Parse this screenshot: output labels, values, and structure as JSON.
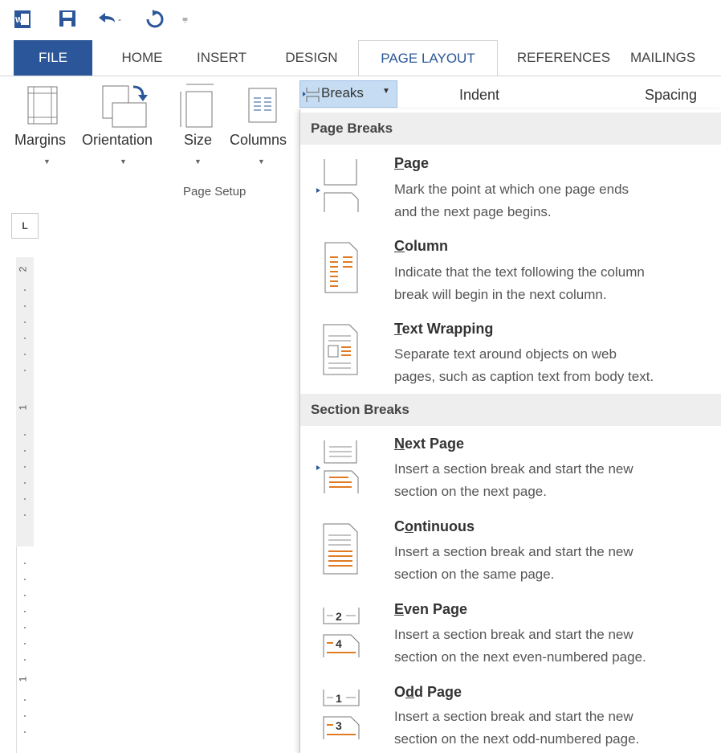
{
  "tabs": [
    "FILE",
    "HOME",
    "INSERT",
    "DESIGN",
    "PAGE LAYOUT",
    "REFERENCES",
    "MAILINGS"
  ],
  "ribbon": {
    "buttons": [
      "Margins",
      "Orientation",
      "Size",
      "Columns"
    ],
    "group_label": "Page Setup",
    "breaks_label": "Breaks",
    "indent_label": "Indent",
    "spacing_label": "Spacing"
  },
  "ruler": {
    "tab_selector": "L",
    "numbers": [
      "2",
      "1",
      "1"
    ]
  },
  "menu": {
    "page_breaks_header": "Page Breaks",
    "section_breaks_header": "Section Breaks",
    "items": [
      {
        "pre": "",
        "u": "P",
        "post": "age",
        "desc1": "Mark the point at which one page ends",
        "desc2": "and the next page begins."
      },
      {
        "pre": "",
        "u": "C",
        "post": "olumn",
        "desc1": "Indicate that the text following the column",
        "desc2": "break will begin in the next column."
      },
      {
        "pre": "",
        "u": "T",
        "post": "ext Wrapping",
        "desc1": "Separate text around objects on web",
        "desc2": "pages, such as caption text from body text."
      },
      {
        "pre": "",
        "u": "N",
        "post": "ext Page",
        "desc1": "Insert a section break and start the new",
        "desc2": "section on the next page."
      },
      {
        "pre": "C",
        "u": "o",
        "post": "ntinuous",
        "desc1": "Insert a section break and start the new",
        "desc2": "section on the same page."
      },
      {
        "pre": "",
        "u": "E",
        "post": "ven Page",
        "desc1": "Insert a section break and start the new",
        "desc2": "section on the next even-numbered page."
      },
      {
        "pre": "O",
        "u": "d",
        "post": "d Page",
        "desc1": "Insert a section break and start the new",
        "desc2": "section on the next odd-numbered page."
      }
    ]
  },
  "icons": {
    "word": "word-app-icon",
    "save": "save-icon",
    "undo": "undo-icon",
    "redo": "redo-icon",
    "customize": "customize-qat-icon"
  },
  "colors": {
    "file_tab": "#2b579a",
    "accent_orange": "#e07b24",
    "breaks_highlight": "#c5dcf2"
  }
}
